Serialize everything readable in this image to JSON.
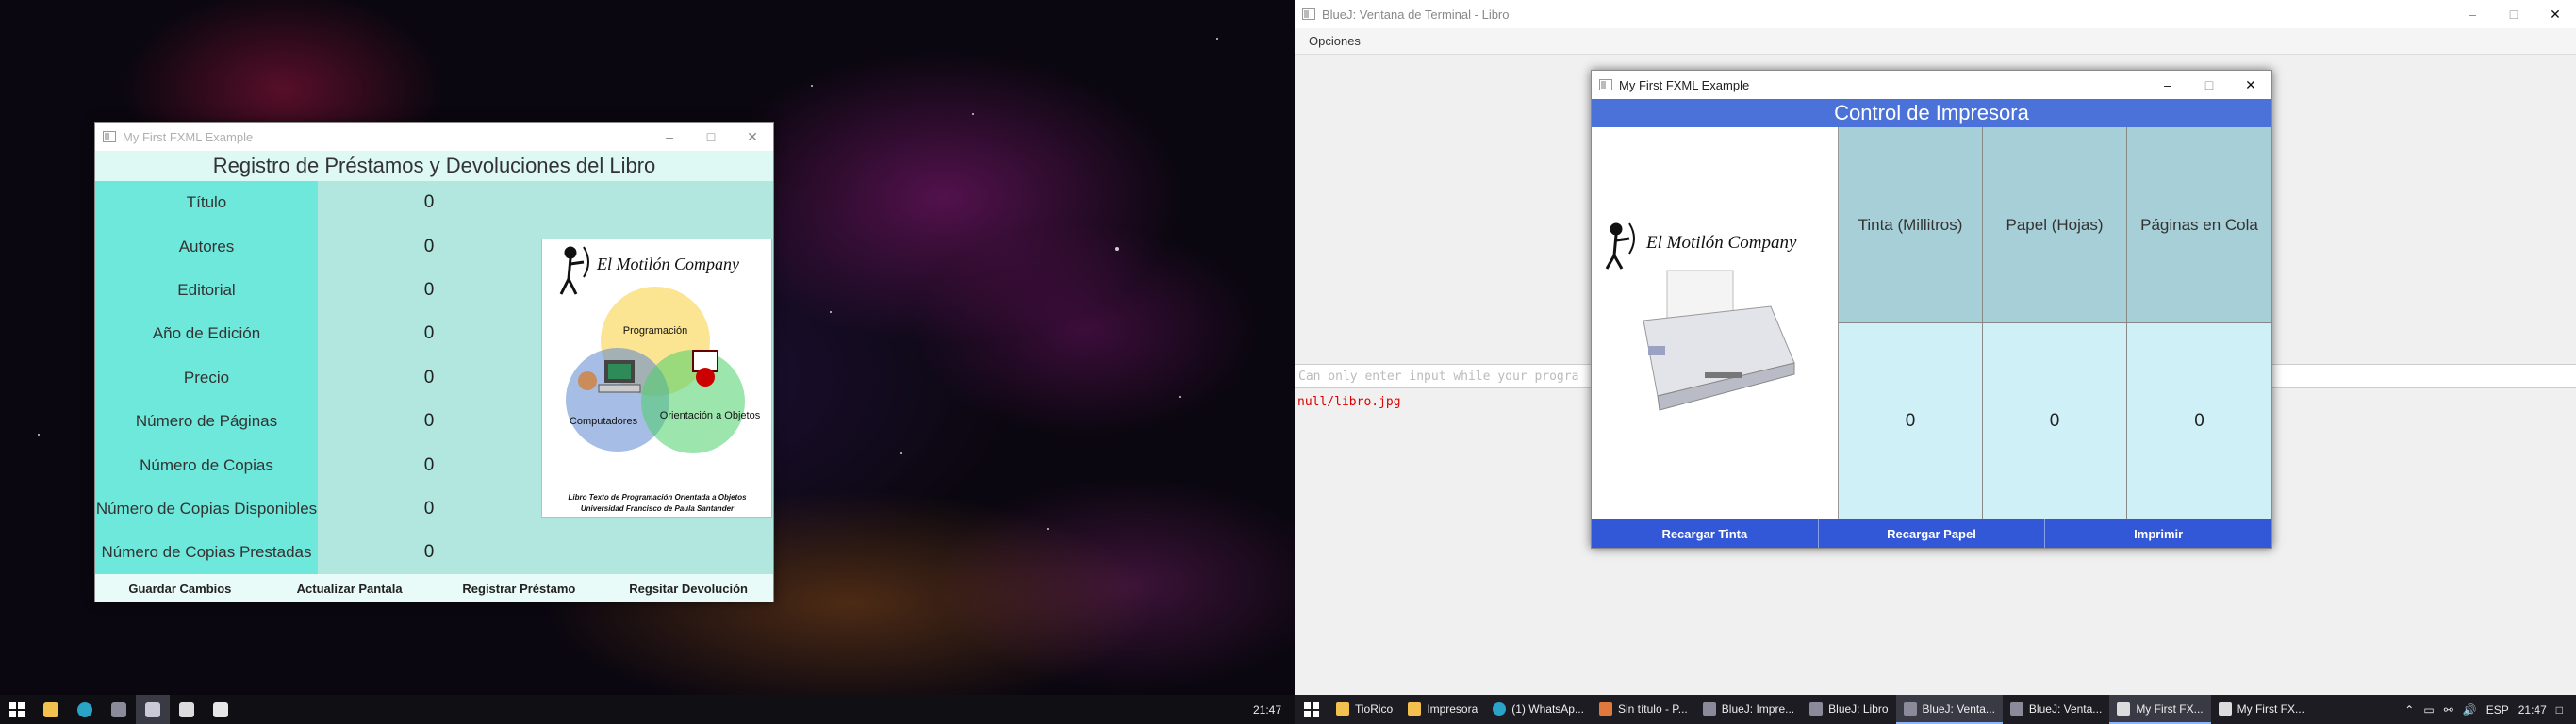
{
  "left_window": {
    "title": "My First FXML Example",
    "header": "Registro de Préstamos y Devoluciones del Libro",
    "rows": [
      {
        "label": "Título",
        "value": "0"
      },
      {
        "label": "Autores",
        "value": "0"
      },
      {
        "label": "Editorial",
        "value": "0"
      },
      {
        "label": "Año de Edición",
        "value": "0"
      },
      {
        "label": "Precio",
        "value": "0"
      },
      {
        "label": "Número de Páginas",
        "value": "0"
      },
      {
        "label": "Número de Copias",
        "value": "0"
      },
      {
        "label": "Número de Copias Disponibles",
        "value": "0"
      },
      {
        "label": "Número de Copias Prestadas",
        "value": "0"
      }
    ],
    "logo": {
      "company": "El Motilón Company",
      "venn": [
        "Programación",
        "Computadores",
        "Orientación a Objetos"
      ],
      "caption_line1": "Libro Texto de Programación Orientada a Objetos",
      "caption_line2": "Universidad Francisco de Paula Santander"
    },
    "buttons": [
      "Guardar Cambios",
      "Actualizar Pantala",
      "Registrar Préstamo",
      "Regsitar Devolución"
    ]
  },
  "terminal": {
    "title": "BlueJ: Ventana de Terminal - Libro",
    "menu": "Opciones",
    "input_placeholder": "Can only enter input while your progra",
    "output": "null/libro.jpg"
  },
  "printer_window": {
    "title": "My First FXML Example",
    "header": "Control de Impresora",
    "company": "El Motilón Company",
    "columns": [
      {
        "label": "Tinta (Millitros)",
        "value": "0"
      },
      {
        "label": "Papel (Hojas)",
        "value": "0"
      },
      {
        "label": "Páginas en Cola",
        "value": "0"
      }
    ],
    "buttons": [
      "Recargar Tinta",
      "Recargar Papel",
      "Imprimir"
    ]
  },
  "taskbar_left": {
    "icons": [
      "start-icon",
      "file-explorer-icon",
      "edge-icon",
      "bluej-icon",
      "bluej-active-icon",
      "java-window-icon",
      "java-window-icon-2"
    ],
    "clock": "21:47"
  },
  "taskbar_right": {
    "apps": [
      "TioRico",
      "Impresora",
      "(1) WhatsAp...",
      "Sin título - P...",
      "BlueJ: Impre...",
      "BlueJ: Libro",
      "BlueJ: Venta...",
      "BlueJ: Venta...",
      "My First FX...",
      "My First FX..."
    ],
    "lang": "ESP",
    "clock": "21:47"
  }
}
